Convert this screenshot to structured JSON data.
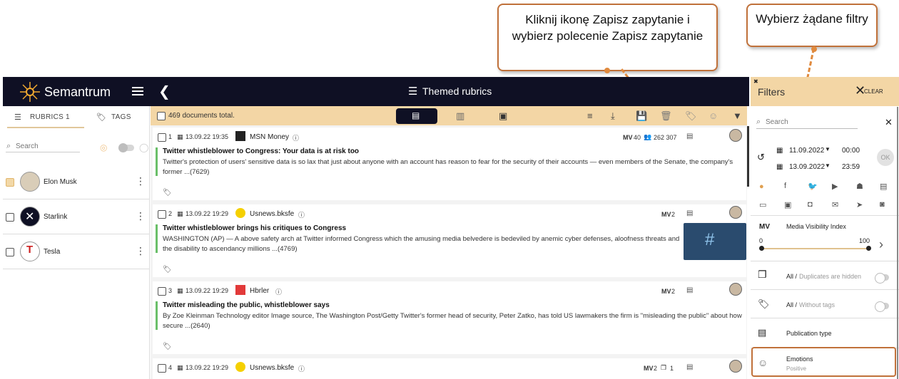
{
  "callouts": {
    "save_query": "Kliknij ikonę Zapisz zapytanie i wybierz polecenie Zapisz zapytanie",
    "filters": "Wybierz żądane filtry"
  },
  "app": {
    "name": "Semantrum",
    "header_title": "Themed rubrics"
  },
  "left": {
    "tab_rubrics": "RUBRICS",
    "rubrics_count": "1",
    "tab_tags": "TAGS",
    "search_placeholder": "Search",
    "rubrics": [
      {
        "name": "Elon Musk",
        "checked": true
      },
      {
        "name": "Starlink",
        "checked": false
      },
      {
        "name": "Tesla",
        "checked": false
      }
    ]
  },
  "main": {
    "documents_total": "469 documents total.",
    "articles": [
      {
        "num": "1",
        "datetime": "13.09.22 19:35",
        "source": "MSN Money",
        "mv": "40",
        "reach": "262 307",
        "title": "Twitter whistleblower to Congress: Your data is at risk too",
        "text": "Twitter's protection of users' sensitive data is so lax that just about anyone with an account has reason to fear for the security of their accounts — even members of the Senate, the company's former ...(7629)"
      },
      {
        "num": "2",
        "datetime": "13.09.22 19:29",
        "source": "Usnews.bksfe",
        "mv": "2",
        "title": "Twitter whistleblower brings his critiques to Congress",
        "text": "WASHINGTON (AP) — A above safety arch at Twitter informed Congress which the amusing media belvedere is bedeviled by anemic cyber defenses, aloofness threats and the disability to ascendancy millions ...(4769)"
      },
      {
        "num": "3",
        "datetime": "13.09.22 19:29",
        "source": "Hbrler",
        "mv": "2",
        "title": "Twitter misleading the public, whistleblower says",
        "text": "By Zoe Kleinman Technology editor Image source, The Washington Post/Getty Twitter's former head of security, Peter Zatko, has told US lawmakers the firm is \"misleading the public\" about how secure ...(2640)"
      },
      {
        "num": "4",
        "datetime": "13.09.22 19:29",
        "source": "Usnews.bksfe",
        "mv": "2",
        "extra": "1"
      }
    ]
  },
  "filters": {
    "title": "Filters",
    "clear": "CLEAR",
    "search_placeholder": "Search",
    "date_from": "11.09.2022",
    "time_from": "00:00",
    "date_to": "13.09.2022",
    "time_to": "23:59",
    "ok": "OK",
    "mv_abbr": "MV",
    "mv_title": "Media Visibility Index",
    "mv_min": "0",
    "mv_max": "100",
    "duplicates_all": "All /",
    "duplicates_sub": "Duplicates are hidden",
    "tags_all": "All /",
    "tags_sub": "Without tags",
    "publication_type": "Publication type",
    "emotions": "Emotions",
    "emotions_sub": "Positive"
  },
  "colors": {
    "header_bg": "#0f1024",
    "accent": "#f3d6a5",
    "callout_border": "#c0713a",
    "positive": "#6abf69"
  }
}
